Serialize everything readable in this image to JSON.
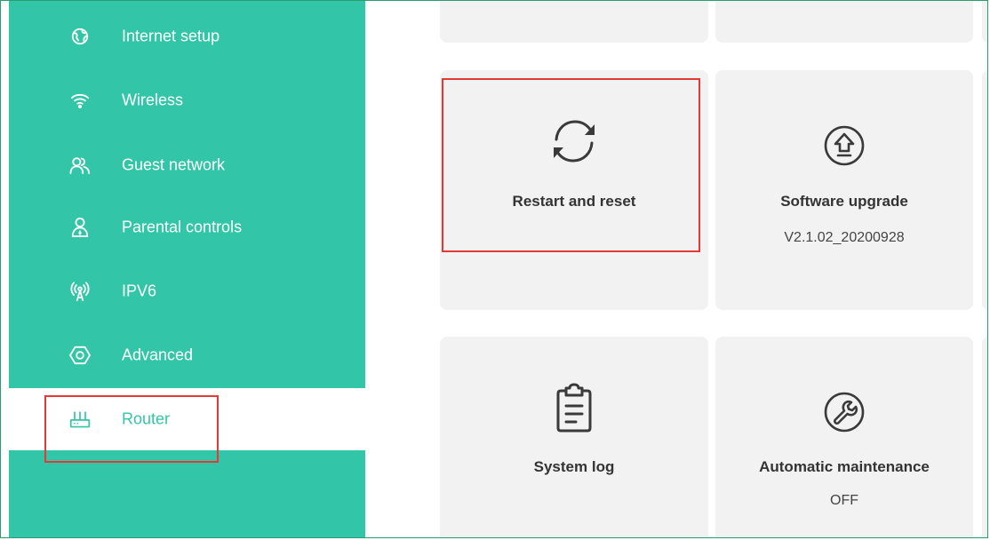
{
  "colors": {
    "sidebar_bg": "#33c5a7",
    "active_bg": "#ffffff",
    "active_text": "#33c5a7",
    "card_bg": "#f2f2f2",
    "highlight": "#e53935"
  },
  "sidebar": {
    "items": [
      {
        "label": "Internet setup",
        "icon": "globe-icon"
      },
      {
        "label": "Wireless",
        "icon": "wifi-icon"
      },
      {
        "label": "Guest network",
        "icon": "guests-icon"
      },
      {
        "label": "Parental controls",
        "icon": "parental-icon"
      },
      {
        "label": "IPV6",
        "icon": "ipv6-icon"
      },
      {
        "label": "Advanced",
        "icon": "hexagon-icon"
      },
      {
        "label": "Router",
        "icon": "router-icon",
        "active": true
      }
    ]
  },
  "cards": [
    {
      "title": "Restart and reset",
      "subtitle": "",
      "icon": "restart-icon"
    },
    {
      "title": "Software upgrade",
      "subtitle": "V2.1.02_20200928",
      "icon": "upload-icon"
    },
    {
      "title": "System log",
      "subtitle": "",
      "icon": "clipboard-icon"
    },
    {
      "title": "Automatic maintenance",
      "subtitle": "OFF",
      "icon": "wrench-icon"
    }
  ]
}
